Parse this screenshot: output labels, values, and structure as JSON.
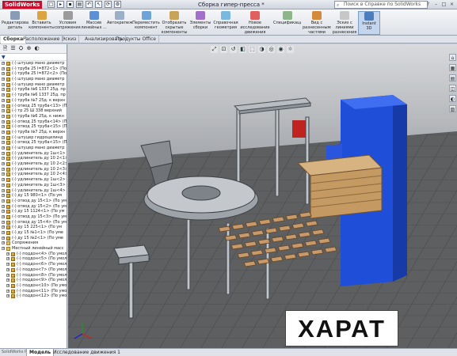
{
  "app": {
    "logo": "SolidWorks",
    "title": "Сборка гипер-пресса *"
  },
  "search": {
    "placeholder": "Поиск в Справке по SolidWorks"
  },
  "quick_access": [
    "new-doc-icon",
    "open-icon",
    "save-icon",
    "print-icon",
    "undo-icon",
    "select-icon",
    "rebuild-icon",
    "options-icon"
  ],
  "ribbon": {
    "buttons": [
      {
        "label": "Редактировать деталь",
        "color": "#8a9bb5"
      },
      {
        "label": "Вставить компоненты",
        "color": "#d9a441"
      },
      {
        "label": "Условия сопряжения",
        "color": "#9b9b9b"
      },
      {
        "label": "Массив линейных ...",
        "color": "#5c8fd6"
      },
      {
        "label": "Автокрепеж",
        "color": "#9bb0c7"
      },
      {
        "label": "Переместить компонент",
        "color": "#6fa3d8"
      },
      {
        "label": "Отобразить скрытые компоненты",
        "color": "#c9a35a"
      },
      {
        "label": "Элементы сборки",
        "color": "#a26fc9"
      },
      {
        "label": "Справочная геометрия",
        "color": "#7ab8e0"
      },
      {
        "label": "Новое исследование движения",
        "color": "#e06060"
      },
      {
        "label": "Спецификация",
        "color": "#8fb58a"
      },
      {
        "label": "Вид с разнесенными частями",
        "color": "#d48a3c"
      },
      {
        "label": "Эскиз с линиями разнесения",
        "color": "#c7c7c7"
      },
      {
        "label": "Instant 3D",
        "color": "#4c7cc0"
      }
    ]
  },
  "tabs": [
    "Сборка",
    "Расположение",
    "Эскиз",
    "Анализировать",
    "Продукты Office"
  ],
  "tree": {
    "filter": "▼",
    "items": [
      {
        "label": "(-) штуцер мано диаметр",
        "level": 1
      },
      {
        "label": "(-) труба 25 l=872<1> (По",
        "level": 1
      },
      {
        "label": "(-) труба 25 l=872<2> (По",
        "level": 1
      },
      {
        "label": "(-) штуцер мано диаметр",
        "level": 1
      },
      {
        "label": "(-) штуцер мано диаметр",
        "level": 1
      },
      {
        "label": "(-) труба №6 1337 25д. пр",
        "level": 1
      },
      {
        "label": "(-) труба №6 1337 25д. пр",
        "level": 1
      },
      {
        "label": "(-) труба №7 25д. к верхн",
        "level": 1
      },
      {
        "label": "(-) отвод 25 труба<13> (П",
        "level": 1
      },
      {
        "label": "(-) тр 25 Ш 338 верхний",
        "level": 1
      },
      {
        "label": "(-) труба №6 25д. к нижн",
        "level": 1
      },
      {
        "label": "(-) отвод 25 труба<14> (П",
        "level": 1
      },
      {
        "label": "(-) отвод 25 труба<15> (П",
        "level": 1
      },
      {
        "label": "(-) труба №7 25д. к верхн",
        "level": 1
      },
      {
        "label": "(-) штуцер гидроцилинд",
        "level": 1
      },
      {
        "label": "(-) отвод 25 труба<15> (П",
        "level": 1
      },
      {
        "label": "(-) штуцер мано диаметр",
        "level": 1
      },
      {
        "label": "(-) удлинитель ду 1ш<1>",
        "level": 1
      },
      {
        "label": "(-) удлинитель ду 10 2<1>",
        "level": 1
      },
      {
        "label": "(-) удлинитель ду 10 2<2>",
        "level": 1
      },
      {
        "label": "(-) удлинитель ду 10 2<3>",
        "level": 1
      },
      {
        "label": "(-) удлинитель ду 10 2<4>",
        "level": 1
      },
      {
        "label": "(-) удлинитель ду 1ш<2>",
        "level": 1
      },
      {
        "label": "(-) удлинитель ду 1ш<3>",
        "level": 1
      },
      {
        "label": "(-) удлинитель ду 1ш<4>",
        "level": 1
      },
      {
        "label": "(-) дy 15  980<1> (По ум",
        "level": 1
      },
      {
        "label": "(-) отвод ду 15<1> (По ум",
        "level": 1
      },
      {
        "label": "(-) отвод ду 15<2> (По ум",
        "level": 1
      },
      {
        "label": "(-) ду 15  1124<1> (По ум",
        "level": 1
      },
      {
        "label": "(-) отвод ду 15<3> (По ум",
        "level": 1
      },
      {
        "label": "(-) отвод ду 15<4> (По ум",
        "level": 1
      },
      {
        "label": "(-) ду 15  225<1> (По ум",
        "level": 1
      },
      {
        "label": "(-) ду 15  №1<1> (По уме",
        "level": 1
      },
      {
        "label": "(-) ду 15  №2<1> (По уме",
        "level": 1
      },
      {
        "label": "Сопряжения",
        "level": 0
      },
      {
        "label": "Местный линейный масс",
        "level": 0
      },
      {
        "label": "(-) поддон<4> (По умолч",
        "level": 2
      },
      {
        "label": "(-) поддон<5> (По умолч",
        "level": 2
      },
      {
        "label": "(-) поддон<6> (По умолч",
        "level": 2
      },
      {
        "label": "(-) поддон<7> (По умолч",
        "level": 2
      },
      {
        "label": "(-) поддон<8> (По умолч",
        "level": 2
      },
      {
        "label": "(-) поддон<9> (По умолч",
        "level": 2
      },
      {
        "label": "(-) поддон<10> (По умол",
        "level": 2
      },
      {
        "label": "(-) поддон<11> (По умол",
        "level": 2
      },
      {
        "label": "(-) поддон<12> (По умол",
        "level": 2
      }
    ]
  },
  "hud": [
    "zoom-fit-icon",
    "zoom-area-icon",
    "previous-view-icon",
    "section-view-icon",
    "view-orientation-icon",
    "display-style-icon",
    "hide-show-icon",
    "appearance-icon",
    "scene-icon"
  ],
  "task_pane": [
    "home-icon",
    "library-icon",
    "file-explorer-icon",
    "view-palette-icon",
    "appearances-icon",
    "custom-properties-icon"
  ],
  "watermark": "ХАРАТ",
  "bottom_tabs": [
    "Модель",
    "Исследование движения 1"
  ],
  "status_text": "SolidWorks Premium"
}
